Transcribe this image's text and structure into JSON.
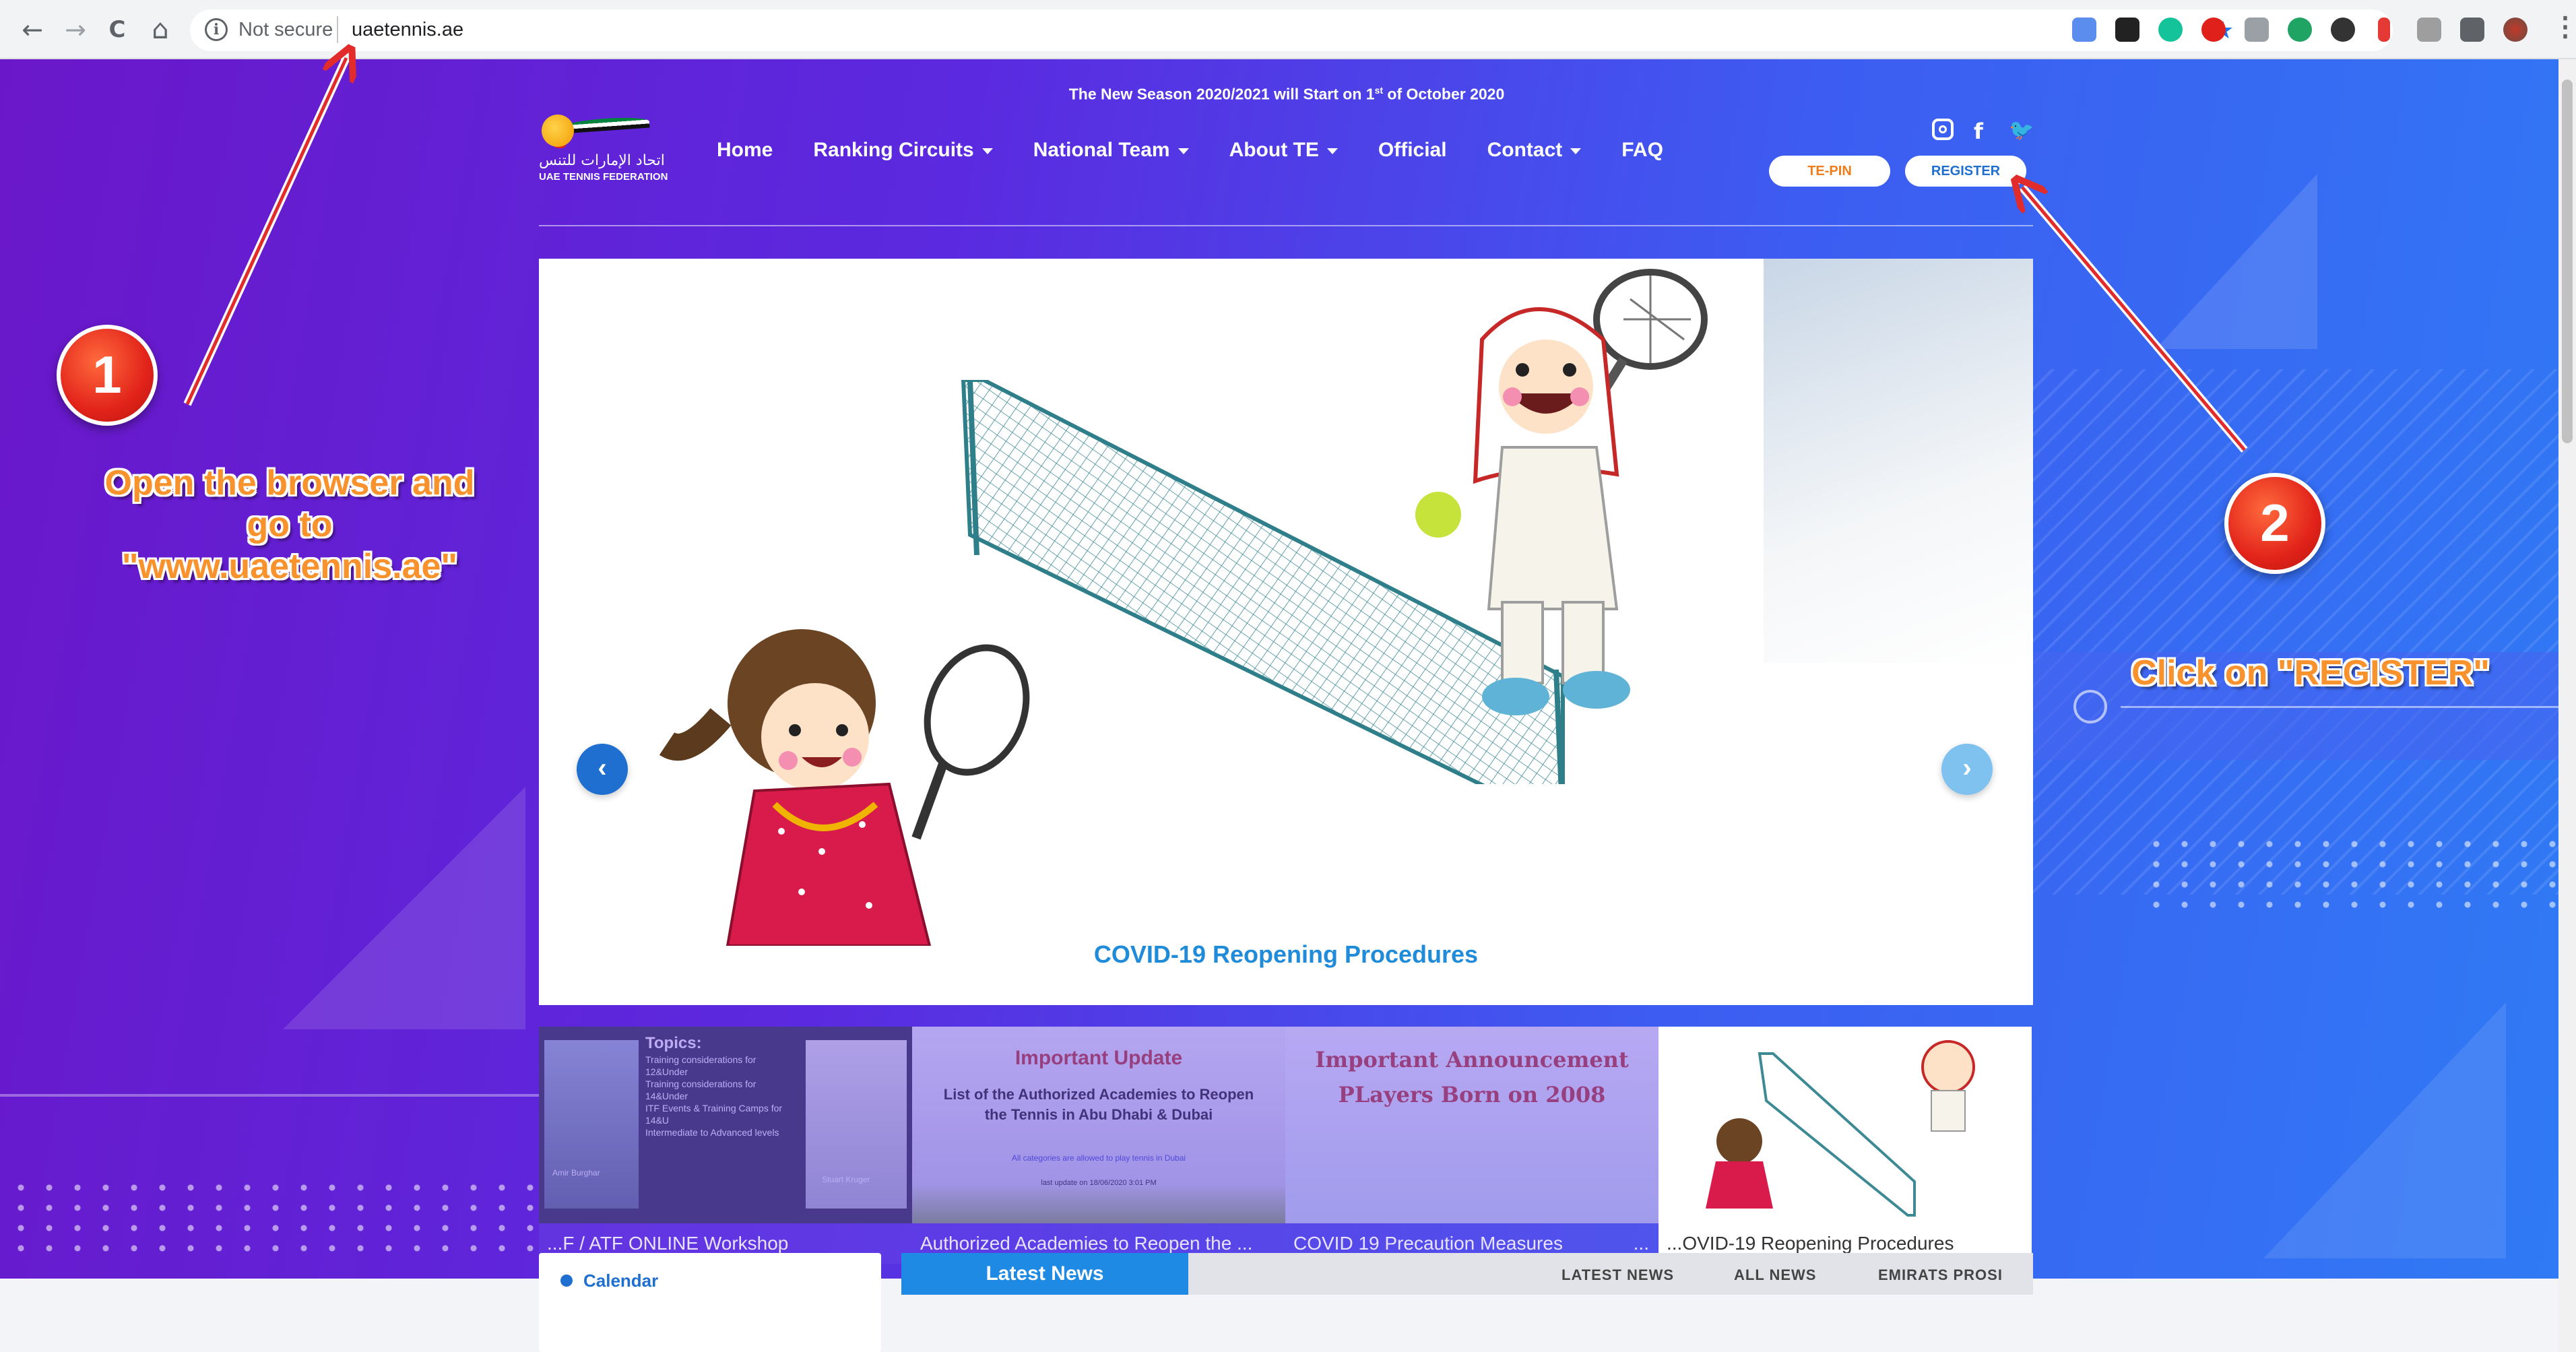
{
  "browser": {
    "nav": {
      "back": "←",
      "forward": "→",
      "reload": "C",
      "home": "⌂"
    },
    "security_label": "Not secure",
    "url": "uaetennis.ae",
    "menu_glyph": "⋮"
  },
  "site": {
    "announcement_prefix": "The New Season 2020/2021 will Start on 1",
    "announcement_sup": "st",
    "announcement_suffix": " of October 2020",
    "logo": {
      "arabic": "اتحاد الإمارات للتنس",
      "english": "UAE TENNIS FEDERATION"
    },
    "nav": [
      {
        "label": "Home",
        "dropdown": false
      },
      {
        "label": "Ranking Circuits",
        "dropdown": true
      },
      {
        "label": "National Team",
        "dropdown": true
      },
      {
        "label": "About TE",
        "dropdown": true
      },
      {
        "label": "Official",
        "dropdown": false
      },
      {
        "label": "Contact",
        "dropdown": true
      },
      {
        "label": "FAQ",
        "dropdown": false
      }
    ],
    "social": [
      "instagram-icon",
      "facebook-icon",
      "twitter-icon"
    ],
    "te_pin_label": "TE-PIN",
    "register_label": "REGISTER"
  },
  "slider": {
    "caption": "COVID-19 Reopening Procedures",
    "prev": "‹",
    "next": "›"
  },
  "thumbnails": [
    {
      "caption": "...F / ATF ONLINE Workshop",
      "topics_title": "Topics:",
      "topics": [
        "Training considerations for 12&Under",
        "Training considerations for 14&Under",
        "ITF Events & Training Camps for 14&U",
        "Intermediate to Advanced levels"
      ],
      "name_left": "Amir Burghar",
      "name_right": "Stuart Kruger"
    },
    {
      "caption": "Authorized Academies to Reopen the ...",
      "heading": "Important Update",
      "body": "List of the Authorized Academies to Reopen the Tennis in Abu Dhabi & Dubai",
      "note": "All categories are allowed to play tennis in Dubai",
      "update": "last update on 18/06/2020 3:01 PM"
    },
    {
      "caption": "COVID 19 Precaution Measures",
      "heading": "Important Announcement",
      "body": "PLayers Born on 2008",
      "more": "..."
    },
    {
      "caption": "...OVID-19 Reopening Procedures"
    }
  ],
  "bottom": {
    "calendar_label": "Calendar",
    "latest_news": "Latest News",
    "tabs": [
      "LATEST NEWS",
      "ALL NEWS",
      "EMIRATS PROSI"
    ]
  },
  "annotations": {
    "step1_number": "1",
    "step1_text": [
      "Open the browser and",
      "go to",
      "\"www.uaetennis.ae\""
    ],
    "step2_number": "2",
    "step2_text": "Click on \"REGISTER\""
  },
  "colors": {
    "accent": "#1f8ae3",
    "te_pin": "#f07c1a",
    "register": "#1f6fd1",
    "instruction": "#f7922d",
    "badge": "#e2231a"
  }
}
